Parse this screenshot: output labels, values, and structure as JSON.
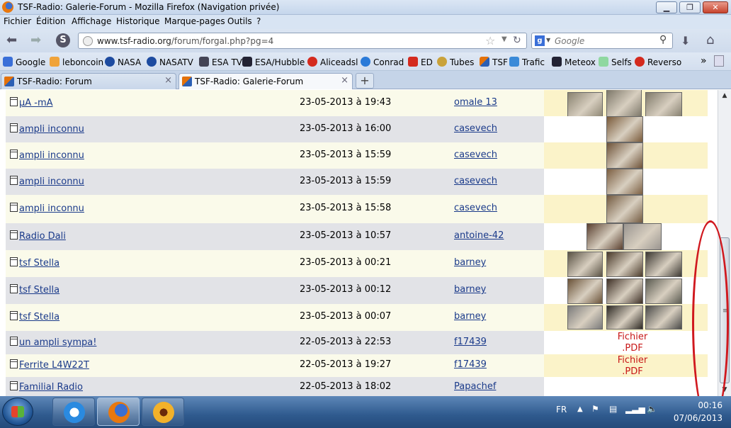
{
  "window": {
    "title": "TSF-Radio: Galerie-Forum - Mozilla Firefox (Navigation privée)",
    "min": "▁",
    "max": "❐",
    "close": "✕"
  },
  "menu": [
    "Fichier",
    "Édition",
    "Affichage",
    "Historique",
    "Marque-pages",
    "Outils",
    "?"
  ],
  "nav": {
    "url_host": "www.tsf-radio.org",
    "url_path": "/forum/forgal.php?pg=4",
    "search_engine": "Google",
    "search_placeholder": "Google"
  },
  "bookmarks": [
    "Google",
    "leboncoin",
    "NASA",
    "NASATV",
    "ESA TV",
    "ESA/Hubble",
    "Aliceadsl",
    "Conrad",
    "ED",
    "Tubes",
    "TSF",
    "Trafic",
    "Meteox",
    "Selfs",
    "Reverso"
  ],
  "bookmarks_more": "»",
  "tabs": [
    {
      "label": "TSF-Radio: Forum",
      "active": false
    },
    {
      "label": "TSF-Radio: Galerie-Forum",
      "active": true
    }
  ],
  "newtab_label": "+",
  "rows": [
    {
      "title": "µA -mA",
      "date": "23-05-2013 à 19:43",
      "author": "omale 13"
    },
    {
      "title": "ampli inconnu",
      "date": "23-05-2013 à 16:00",
      "author": "casevech"
    },
    {
      "title": "ampli inconnu",
      "date": "23-05-2013 à 15:59",
      "author": "casevech"
    },
    {
      "title": "ampli inconnu",
      "date": "23-05-2013 à 15:59",
      "author": "casevech"
    },
    {
      "title": "ampli inconnu",
      "date": "23-05-2013 à 15:58",
      "author": "casevech"
    },
    {
      "title": "Radio Dali",
      "date": "23-05-2013 à 10:57",
      "author": "antoine-42"
    },
    {
      "title": "tsf Stella",
      "date": "23-05-2013 à 00:21",
      "author": "barney"
    },
    {
      "title": "tsf Stella",
      "date": "23-05-2013 à 00:12",
      "author": "barney"
    },
    {
      "title": "tsf Stella",
      "date": "23-05-2013 à 00:07",
      "author": "barney"
    },
    {
      "title": "un ampli sympa!",
      "date": "22-05-2013 à 22:53",
      "author": "f17439",
      "attachment": "Fichier\n.PDF"
    },
    {
      "title": "Ferrite L4W22T",
      "date": "22-05-2013 à 19:27",
      "author": "f17439",
      "attachment": "Fichier\n.PDF"
    },
    {
      "title": "Familial Radio",
      "date": "22-05-2013 à 18:02",
      "author": "Papachef"
    }
  ],
  "taskbar": {
    "lang": "FR",
    "time": "00:16",
    "date": "07/06/2013"
  },
  "colors": {
    "row_light": "#fafaea",
    "row_dark": "#e2e3e7",
    "thumb_col_light": "#fbf3c9",
    "link": "#1a3a8a",
    "pdf": "#c81818",
    "annotation": "#d0181e"
  }
}
